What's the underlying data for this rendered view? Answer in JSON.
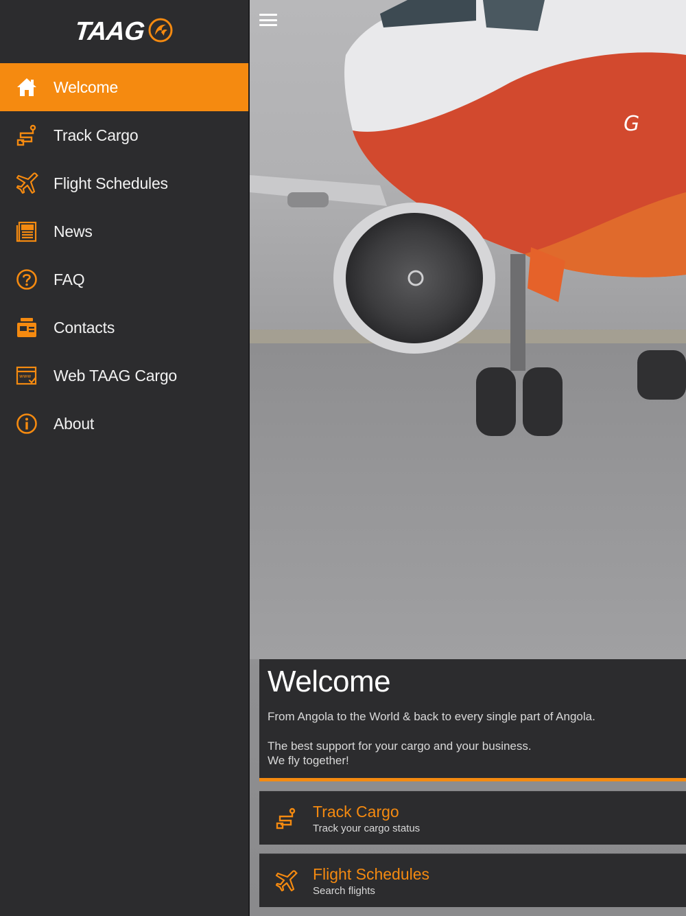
{
  "brand": {
    "logo_text": "TAAG",
    "accent": "#f58a10"
  },
  "sidebar": {
    "items": [
      {
        "label": "Welcome",
        "icon": "home-icon",
        "active": true
      },
      {
        "label": "Track Cargo",
        "icon": "track-cargo-icon"
      },
      {
        "label": "Flight Schedules",
        "icon": "airplane-icon"
      },
      {
        "label": "News",
        "icon": "newspaper-icon"
      },
      {
        "label": "FAQ",
        "icon": "question-circle-icon"
      },
      {
        "label": "Contacts",
        "icon": "contacts-card-icon"
      },
      {
        "label": "Web TAAG Cargo",
        "icon": "web-browser-icon"
      },
      {
        "label": "About",
        "icon": "info-circle-icon"
      }
    ]
  },
  "welcome": {
    "title": "Welcome",
    "line1": "From Angola to the World & back to every single part of Angola.",
    "line2": "The best support for your cargo and your business.",
    "line3": "We fly together!"
  },
  "actions": [
    {
      "title": "Track Cargo",
      "subtitle": "Track your cargo status",
      "icon": "track-cargo-icon"
    },
    {
      "title": "Flight Schedules",
      "subtitle": "Search flights",
      "icon": "airplane-icon"
    }
  ]
}
